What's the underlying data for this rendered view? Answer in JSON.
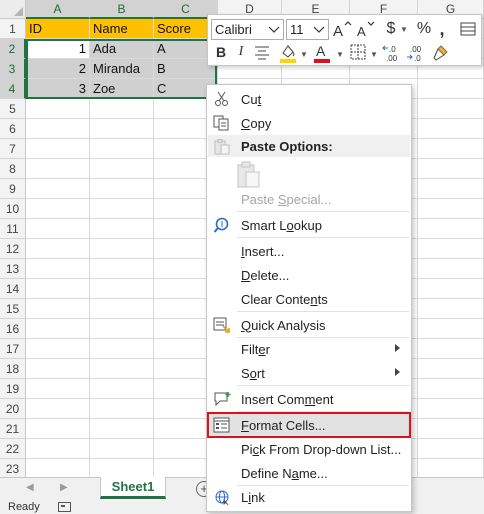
{
  "columns": [
    "A",
    "B",
    "C",
    "D",
    "E",
    "F",
    "G"
  ],
  "rows": [
    "1",
    "2",
    "3",
    "4",
    "5",
    "6",
    "7",
    "8",
    "9",
    "10",
    "11",
    "12",
    "13",
    "14",
    "15",
    "16",
    "17",
    "18",
    "19",
    "20",
    "21",
    "22",
    "23"
  ],
  "table": {
    "header": [
      "ID",
      "Name",
      "Score"
    ],
    "data": [
      [
        "1",
        "Ada",
        "A"
      ],
      [
        "2",
        "Miranda",
        "B"
      ],
      [
        "3",
        "Zoe",
        "C"
      ]
    ]
  },
  "mini_toolbar": {
    "font_name": "Calibri",
    "font_size": "11",
    "font_color": "#e0101a",
    "fill_color": "#ffd400"
  },
  "context_menu": {
    "cut": "Cut",
    "copy": "Copy",
    "paste_options": "Paste Options:",
    "paste_special": "Paste Special...",
    "smart_lookup": "Smart Lookup",
    "insert": "Insert...",
    "delete": "Delete...",
    "clear_contents": "Clear Contents",
    "quick_analysis": "Quick Analysis",
    "filter": "Filter",
    "sort": "Sort",
    "insert_comment": "Insert Comment",
    "format_cells": "Format Cells...",
    "pick_from_list": "Pick From Drop-down List...",
    "define_name": "Define Name...",
    "link": "Link"
  },
  "sheet_tab": "Sheet1",
  "status": "Ready",
  "accent_color": "#217346",
  "header_fill": "#ffc000"
}
